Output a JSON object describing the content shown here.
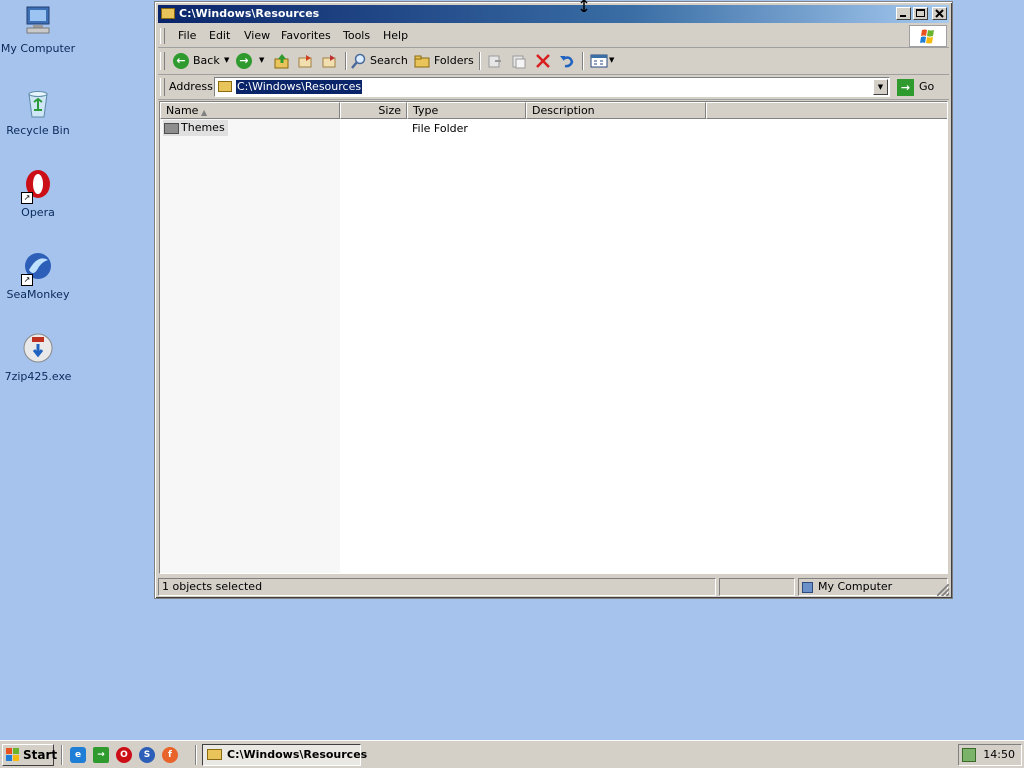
{
  "desktop": {
    "icons": [
      {
        "label": "My Computer",
        "icon": "computer-icon"
      },
      {
        "label": "Recycle Bin",
        "icon": "recycle-bin-icon"
      },
      {
        "label": "Opera",
        "icon": "opera-icon"
      },
      {
        "label": "SeaMonkey",
        "icon": "seamonkey-icon"
      },
      {
        "label": "7zip425.exe",
        "icon": "installer-icon"
      }
    ]
  },
  "window": {
    "title": "C:\\Windows\\Resources",
    "buttons": {
      "minimize": "_",
      "maximize": "□",
      "close": "✕"
    }
  },
  "menubar": {
    "file": "File",
    "edit": "Edit",
    "view": "View",
    "favorites": "Favorites",
    "tools": "Tools",
    "help": "Help"
  },
  "toolbar": {
    "back": "Back",
    "search": "Search",
    "folders": "Folders"
  },
  "addressbar": {
    "label": "Address",
    "value": "C:\\Windows\\Resources",
    "go": "Go"
  },
  "listview": {
    "columns": [
      "Name",
      "Size",
      "Type",
      "Description"
    ],
    "sort_column": "Name",
    "rows": [
      {
        "name": "Themes",
        "size": "",
        "type": "File Folder",
        "description": ""
      }
    ]
  },
  "statusbar": {
    "selection": "1 objects selected",
    "zone": "My Computer"
  },
  "taskbar": {
    "start": "Start",
    "task": "C:\\Windows\\Resources",
    "clock": "14:50"
  },
  "colors": {
    "desktop": "#a5c3ec",
    "titlebar_start": "#0a246a",
    "titlebar_end": "#a6caf0",
    "selection": "#0a246a",
    "chrome": "#d4d0c8"
  }
}
